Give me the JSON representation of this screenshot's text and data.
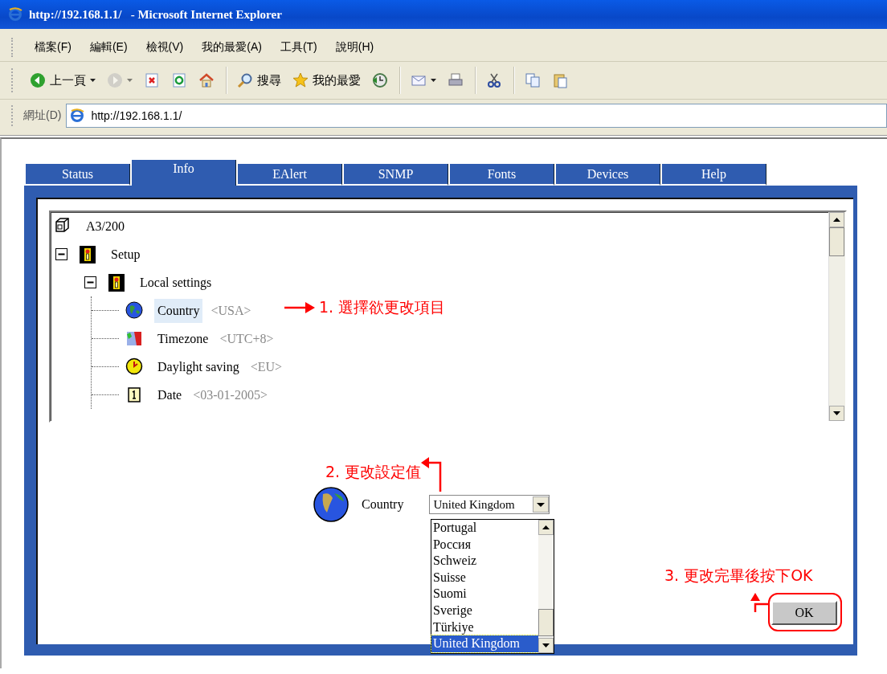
{
  "window": {
    "title": "http://192.168.1.1/   - Microsoft Internet Explorer"
  },
  "menu": [
    "檔案(F)",
    "編輯(E)",
    "檢視(V)",
    "我的最愛(A)",
    "工具(T)",
    "說明(H)"
  ],
  "toolbar": [
    {
      "kind": "back",
      "label": "上一頁",
      "disabled": false
    },
    {
      "kind": "forward",
      "disabled": true
    },
    {
      "kind": "stop",
      "disabled": false
    },
    {
      "kind": "refresh",
      "disabled": false
    },
    {
      "kind": "home",
      "disabled": false
    },
    {
      "kind": "search",
      "label": "搜尋",
      "disabled": false
    },
    {
      "kind": "favorites",
      "label": "我的最愛",
      "disabled": false
    },
    {
      "kind": "history",
      "disabled": false
    },
    {
      "kind": "mail",
      "disabled": false
    },
    {
      "kind": "print",
      "disabled": false
    },
    {
      "kind": "cut",
      "disabled": false
    },
    {
      "kind": "copy",
      "disabled": false
    },
    {
      "kind": "paste",
      "disabled": false
    }
  ],
  "address": {
    "label": "網址(D)",
    "value": "http://192.168.1.1/"
  },
  "tabs": [
    {
      "label": "Status",
      "selected": false
    },
    {
      "label": "Info",
      "selected": true
    },
    {
      "label": "EAlert",
      "selected": false
    },
    {
      "label": "SNMP",
      "selected": false
    },
    {
      "label": "Fonts",
      "selected": false
    },
    {
      "label": "Devices",
      "selected": false
    },
    {
      "label": "Help",
      "selected": false
    }
  ],
  "tree": [
    {
      "kind": "device",
      "label": "A3/200",
      "selected": false
    },
    {
      "kind": "setup",
      "label": "Setup",
      "expanded": true,
      "selected": false,
      "children": [
        {
          "kind": "setup",
          "label": "Local settings",
          "expanded": true,
          "selected": false,
          "children": [
            {
              "kind": "globe",
              "label": "Country",
              "value": "<USA>",
              "selected": true
            },
            {
              "kind": "timezone",
              "label": "Timezone",
              "value": "<UTC+8>",
              "selected": false
            },
            {
              "kind": "clock",
              "label": "Daylight saving",
              "value": "<EU>",
              "selected": false
            },
            {
              "kind": "calendar",
              "label": "Date",
              "value": "<03-01-2005>",
              "selected": false
            }
          ]
        }
      ]
    }
  ],
  "editor": {
    "label": "Country",
    "value": "United Kingdom",
    "options": [
      {
        "label": "Portugal",
        "selected": false
      },
      {
        "label": "Россия",
        "selected": false
      },
      {
        "label": "Schweiz",
        "selected": false
      },
      {
        "label": "Suisse",
        "selected": false
      },
      {
        "label": "Suomi",
        "selected": false
      },
      {
        "label": "Sverige",
        "selected": false
      },
      {
        "label": "Türkiye",
        "selected": false
      },
      {
        "label": "United Kingdom",
        "selected": true
      }
    ]
  },
  "ok_button": "OK",
  "annotations": [
    {
      "kind": "arrow-right",
      "text": "1. 選擇欲更改項目"
    },
    {
      "kind": "arrow-up-left",
      "text": "2. 更改設定值"
    },
    {
      "kind": "ring",
      "text": "3. 更改完畢後按下OK"
    }
  ]
}
